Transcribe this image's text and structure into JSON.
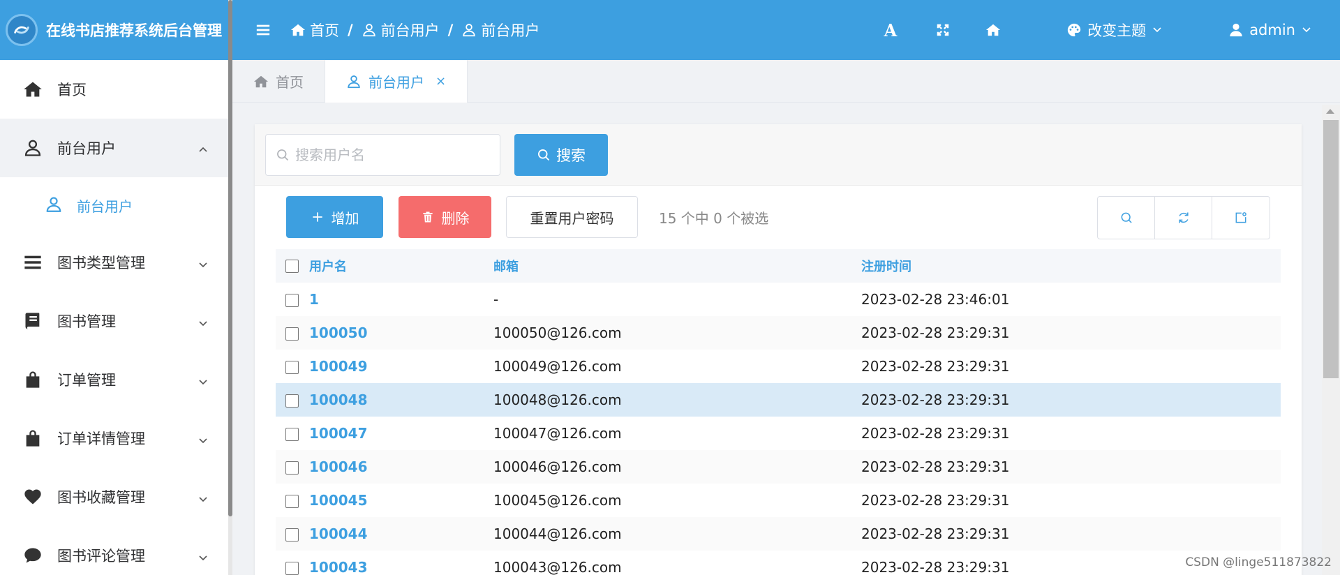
{
  "app": {
    "title": "在线书店推荐系统后台管理"
  },
  "sidebar": {
    "items": [
      {
        "label": "首页",
        "icon": "home-icon"
      },
      {
        "label": "前台用户",
        "icon": "user-icon",
        "open": true
      },
      {
        "label": "图书类型管理",
        "icon": "list-icon"
      },
      {
        "label": "图书管理",
        "icon": "book-icon"
      },
      {
        "label": "订单管理",
        "icon": "shopping-bag-icon"
      },
      {
        "label": "订单详情管理",
        "icon": "shopping-bag-icon"
      },
      {
        "label": "图书收藏管理",
        "icon": "heart-icon"
      },
      {
        "label": "图书评论管理",
        "icon": "comment-icon"
      }
    ],
    "submenu": {
      "label": "前台用户"
    }
  },
  "header": {
    "breadcrumb": [
      "首页",
      "前台用户",
      "前台用户"
    ],
    "separator": "/",
    "font_btn": "A",
    "theme_label": "改变主题",
    "user_label": "admin"
  },
  "tabs": [
    {
      "label": "首页"
    },
    {
      "label": "前台用户",
      "close": "×"
    }
  ],
  "search": {
    "placeholder": "搜索用户名",
    "button_label": "搜索"
  },
  "toolbar": {
    "add_label": "增加",
    "delete_label": "删除",
    "reset_label": "重置用户密码",
    "selection_info": "15 个中 0 个被选"
  },
  "table": {
    "columns": [
      "用户名",
      "邮箱",
      "注册时间"
    ],
    "rows": [
      {
        "username": "1",
        "email": "-",
        "registered": "2023-02-28 23:46:01"
      },
      {
        "username": "100050",
        "email": "100050@126.com",
        "registered": "2023-02-28 23:29:31"
      },
      {
        "username": "100049",
        "email": "100049@126.com",
        "registered": "2023-02-28 23:29:31"
      },
      {
        "username": "100048",
        "email": "100048@126.com",
        "registered": "2023-02-28 23:29:31"
      },
      {
        "username": "100047",
        "email": "100047@126.com",
        "registered": "2023-02-28 23:29:31"
      },
      {
        "username": "100046",
        "email": "100046@126.com",
        "registered": "2023-02-28 23:29:31"
      },
      {
        "username": "100045",
        "email": "100045@126.com",
        "registered": "2023-02-28 23:29:31"
      },
      {
        "username": "100044",
        "email": "100044@126.com",
        "registered": "2023-02-28 23:29:31"
      },
      {
        "username": "100043",
        "email": "100043@126.com",
        "registered": "2023-02-28 23:29:31"
      }
    ]
  },
  "watermark": "CSDN @linge511873822",
  "colors": {
    "primary": "#3d9fe0",
    "danger": "#f56c6c",
    "highlight_row": "#d9eaf7"
  }
}
